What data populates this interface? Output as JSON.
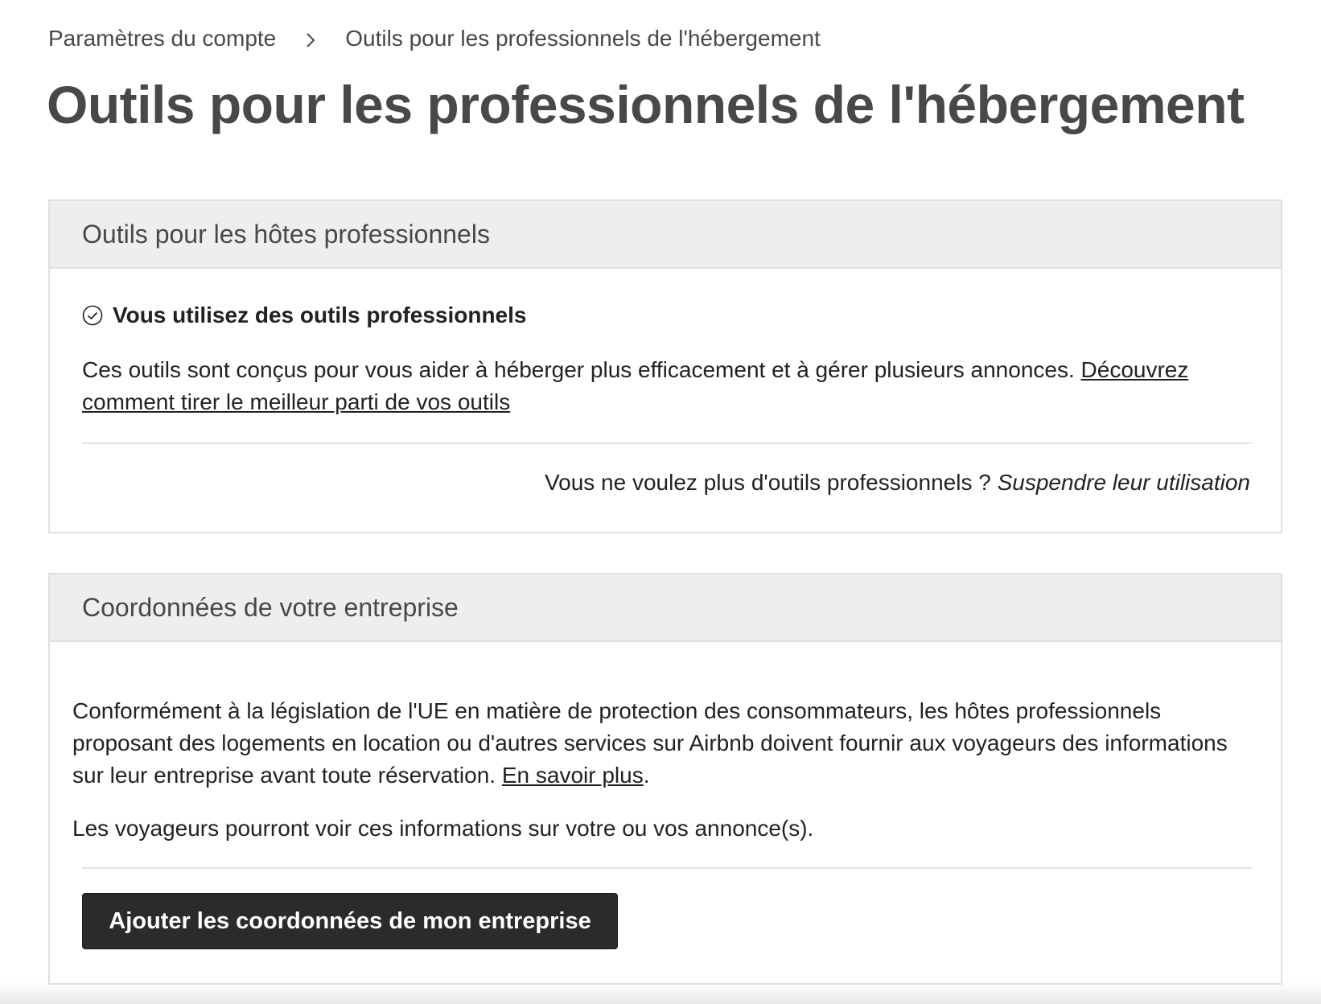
{
  "breadcrumb": {
    "items": [
      {
        "label": "Paramètres du compte"
      },
      {
        "label": "Outils pour les professionnels de l'hébergement"
      }
    ],
    "separator_icon": "chevron-right-icon"
  },
  "page": {
    "title": "Outils pour les professionnels de l'hébergement"
  },
  "pro_tools": {
    "header": "Outils pour les hôtes professionnels",
    "status_icon": "check-circle-icon",
    "status_label": "Vous utilisez des outils professionnels",
    "description": "Ces outils sont conçus pour vous aider à héberger plus efficacement et à gérer plusieurs annonces. ",
    "learn_link": "Découvrez comment tirer le meilleur parti de vos outils",
    "opt_out_question": "Vous ne voulez plus d'outils professionnels ? ",
    "opt_out_link": "Suspendre leur utilisation"
  },
  "business_info": {
    "header": "Coordonnées de votre entreprise",
    "description": "Conformément à la législation de l'UE en matière de protection des consommateurs, les hôtes professionnels proposant des logements en location ou d'autres services sur Airbnb doivent fournir aux voyageurs des informations sur leur entreprise avant toute réservation. ",
    "learn_more_link": "En savoir plus",
    "learn_more_suffix": ".",
    "visibility_note": "Les voyageurs pourront voir ces informations sur votre ou vos annonce(s).",
    "add_button_label": "Ajouter les coordonnées de mon entreprise"
  },
  "colors": {
    "header_bg": "#edefed",
    "border": "#dce0e0",
    "button_bg": "#2b2b2b",
    "title_text": "#484848"
  }
}
